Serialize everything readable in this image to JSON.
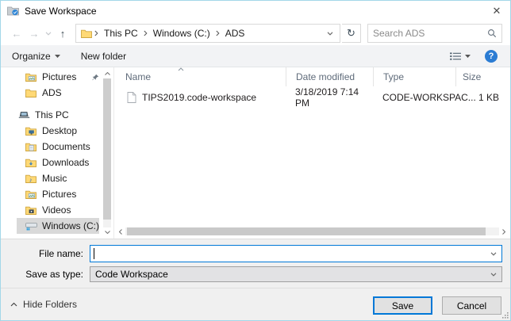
{
  "colors": {
    "accent": "#0078d7",
    "window_border": "#a3d7e8",
    "selection_gray": "#d9d9d9",
    "help_blue": "#2b7cd3",
    "folder_yellow": "#ffd976"
  },
  "titlebar": {
    "title": "Save Workspace"
  },
  "icons": {
    "back": "←",
    "forward": "→",
    "up": "↑",
    "refresh": "↻",
    "close": "✕",
    "help": "?",
    "music_note": "♪"
  },
  "address_bar": {
    "breadcrumb": [
      "This PC",
      "Windows (C:)",
      "ADS"
    ],
    "search_placeholder": "Search ADS"
  },
  "toolbar": {
    "organize": "Organize",
    "new_folder": "New folder"
  },
  "sidebar": {
    "items": [
      {
        "label": "Pictures"
      },
      {
        "label": "ADS"
      },
      {
        "label": "This PC"
      },
      {
        "label": "Desktop"
      },
      {
        "label": "Documents"
      },
      {
        "label": "Downloads"
      },
      {
        "label": "Music"
      },
      {
        "label": "Pictures"
      },
      {
        "label": "Videos"
      },
      {
        "label": "Windows (C:)"
      }
    ]
  },
  "file_list": {
    "columns": [
      "Name",
      "Date modified",
      "Type",
      "Size"
    ],
    "rows": [
      {
        "name": "TIPS2019.code-workspace",
        "date_modified": "3/18/2019 7:14 PM",
        "type": "CODE-WORKSPAC...",
        "size": "1 KB"
      }
    ]
  },
  "form": {
    "file_name_label": "File name:",
    "file_name_value": "",
    "save_as_type_label": "Save as type:",
    "save_as_type_value": "Code Workspace"
  },
  "footer": {
    "hide_folders": "Hide Folders",
    "save": "Save",
    "cancel": "Cancel"
  }
}
